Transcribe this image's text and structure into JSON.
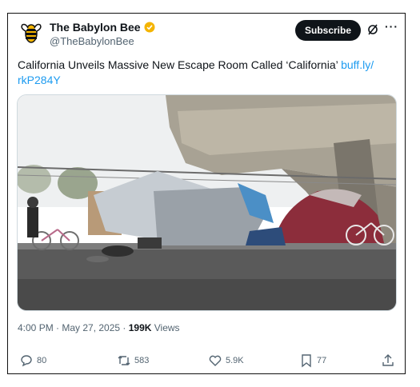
{
  "account": {
    "name": "The Babylon Bee",
    "handle": "@TheBabylonBee",
    "verified_color": "#f4b400"
  },
  "buttons": {
    "subscribe": "Subscribe",
    "more": "···"
  },
  "post": {
    "text": "California Unveils Massive New Escape Room Called ‘California’ ",
    "link": "buff.ly/\nrkP284Y",
    "link_color": "#1d9bf0"
  },
  "meta": {
    "time": "4:00 PM · May 27, 2025 · ",
    "views_count": "199K",
    "views_label": " Views"
  },
  "actions": {
    "replies": "80",
    "reposts": "583",
    "likes": "5.9K",
    "bookmarks": "77"
  },
  "icons": [
    "bee-logo-icon",
    "verified-badge-icon",
    "grok-icon",
    "more-icon",
    "reply-icon",
    "repost-icon",
    "like-icon",
    "bookmark-icon",
    "share-icon"
  ]
}
